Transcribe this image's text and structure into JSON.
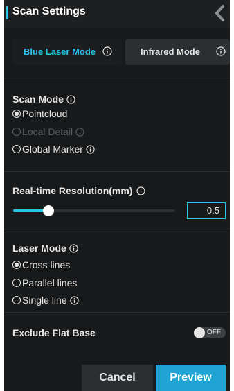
{
  "header": {
    "title": "Scan Settings"
  },
  "mode_tabs": [
    {
      "label": "Blue Laser Mode",
      "active": true
    },
    {
      "label": "Infrared Mode",
      "active": false
    }
  ],
  "scan_mode": {
    "title": "Scan Mode",
    "options": [
      {
        "label": "Pointcloud",
        "checked": true,
        "disabled": false
      },
      {
        "label": "Local Detail",
        "checked": false,
        "disabled": true
      },
      {
        "label": "Global Marker",
        "checked": false,
        "disabled": false
      }
    ]
  },
  "resolution": {
    "title": "Real-time Resolution(mm)",
    "value": "0.5",
    "slider_fraction": 0.22
  },
  "laser_mode": {
    "title": "Laser Mode",
    "options": [
      {
        "label": "Cross lines",
        "checked": true
      },
      {
        "label": "Parallel lines",
        "checked": false
      },
      {
        "label": "Single line",
        "checked": false
      }
    ]
  },
  "exclude_flat_base": {
    "label": "Exclude Flat Base",
    "toggle_label": "OFF",
    "enabled": false
  },
  "actions": {
    "cancel_label": "Cancel",
    "preview_label": "Preview"
  },
  "colors": {
    "accent": "#29c3e8",
    "background": "#17191b",
    "primary_button": "#1ea3d3"
  }
}
